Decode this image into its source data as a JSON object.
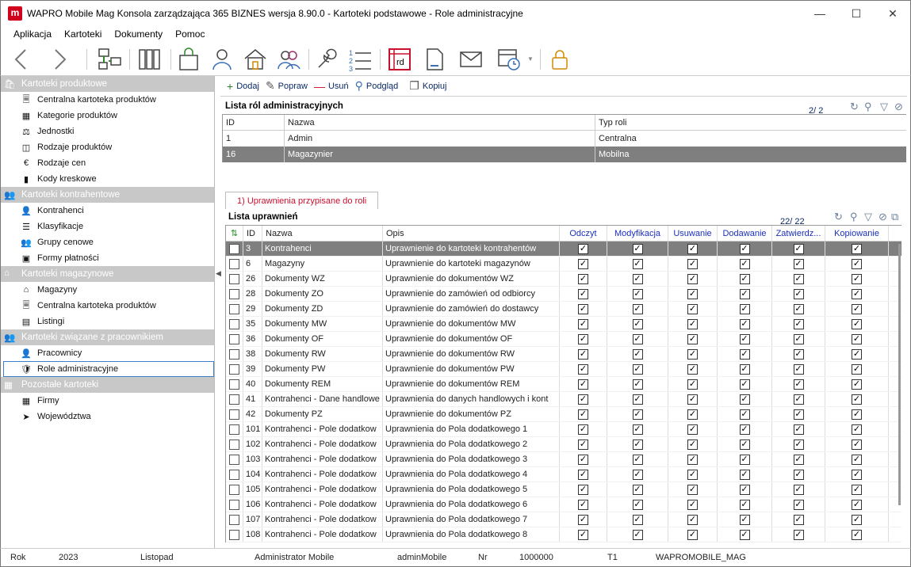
{
  "window": {
    "title": "WAPRO Mobile Mag Konsola zarządzająca 365 BIZNES wersja 8.90.0 - Kartoteki podstawowe - Role administracyjne",
    "app_icon_letter": "m"
  },
  "menu": [
    "Aplikacja",
    "Kartoteki",
    "Dokumenty",
    "Pomoc"
  ],
  "toolbar_icons": [
    "back-arrow-icon",
    "forward-arrow-icon",
    "network-icon",
    "binders-icon",
    "shopping-bag-icon",
    "person-icon",
    "house-icon",
    "users-icon",
    "wrench-icon",
    "numbered-list-icon",
    "rd-calendar-icon",
    "document-icon",
    "envelope-icon",
    "calendar-clock-icon",
    "lock-icon"
  ],
  "toolbar_rd_label": "rd",
  "sidebar": {
    "groups": [
      {
        "title": "Kartoteki produktowe",
        "items": [
          "Centralna kartoteka produktów",
          "Kategorie produktów",
          "Jednostki",
          "Rodzaje produktów",
          "Rodzaje cen",
          "Kody kreskowe"
        ]
      },
      {
        "title": "Kartoteki kontrahentowe",
        "items": [
          "Kontrahenci",
          "Klasyfikacje",
          "Grupy cenowe",
          "Formy płatności"
        ]
      },
      {
        "title": "Kartoteki magazynowe",
        "items": [
          "Magazyny",
          "Centralna kartoteka produktów",
          "Listingi"
        ]
      },
      {
        "title": "Kartoteki związane z pracownikiem",
        "items": [
          "Pracownicy",
          "Role administracyjne"
        ]
      },
      {
        "title": "Pozostałe kartoteki",
        "items": [
          "Firmy",
          "Województwa"
        ]
      }
    ],
    "selected": "Role administracyjne"
  },
  "actions": {
    "add": "Dodaj",
    "edit": "Popraw",
    "delete": "Usuń",
    "preview": "Podgląd",
    "copy": "Kopiuj"
  },
  "roles_panel": {
    "title": "Lista ról administracyjnych",
    "count": "2/ 2",
    "columns": [
      "ID",
      "Nazwa",
      "Typ roli"
    ],
    "rows": [
      {
        "id": "1",
        "name": "Admin",
        "type": "Centralna"
      },
      {
        "id": "16",
        "name": "Magazynier",
        "type": "Mobilna"
      }
    ],
    "selected_index": 1
  },
  "tab_label": "1) Uprawnienia przypisane do roli",
  "perms_panel": {
    "title": "Lista uprawnień",
    "count": "22/ 22",
    "columns": [
      "ID",
      "Nazwa",
      "Opis",
      "Odczyt",
      "Modyfikacja",
      "Usuwanie",
      "Dodawanie",
      "Zatwierdz...",
      "Kopiowanie"
    ],
    "rows": [
      {
        "id": "3",
        "name": "Kontrahenci",
        "desc": "Uprawnienie do kartoteki kontrahentów"
      },
      {
        "id": "6",
        "name": "Magazyny",
        "desc": "Uprawnienie do kartoteki magazynów"
      },
      {
        "id": "26",
        "name": "Dokumenty WZ",
        "desc": "Uprawnienie do dokumentów WZ"
      },
      {
        "id": "28",
        "name": "Dokumenty ZO",
        "desc": "Uprawnienie do zamówień od odbiorcy"
      },
      {
        "id": "29",
        "name": "Dokumenty ZD",
        "desc": "Uprawnienie do zamówień do dostawcy"
      },
      {
        "id": "35",
        "name": "Dokumenty MW",
        "desc": "Uprawnienie do dokumentów MW"
      },
      {
        "id": "36",
        "name": "Dokumenty OF",
        "desc": "Uprawnienie do dokumentów OF"
      },
      {
        "id": "38",
        "name": "Dokumenty RW",
        "desc": "Uprawnienie do dokumentów RW"
      },
      {
        "id": "39",
        "name": "Dokumenty PW",
        "desc": "Uprawnienie do dokumentów PW"
      },
      {
        "id": "40",
        "name": "Dokumenty REM",
        "desc": "Uprawnienie do dokumentów REM"
      },
      {
        "id": "41",
        "name": "Kontrahenci - Dane handlowe",
        "desc": "Uprawnienia do danych handlowych i kont"
      },
      {
        "id": "42",
        "name": "Dokumenty PZ",
        "desc": "Uprawnienie do dokumentów PZ"
      },
      {
        "id": "101",
        "name": "Kontrahenci - Pole dodatkow",
        "desc": "Uprawnienia do Pola dodatkowego 1"
      },
      {
        "id": "102",
        "name": "Kontrahenci - Pole dodatkow",
        "desc": "Uprawnienia do Pola dodatkowego 2"
      },
      {
        "id": "103",
        "name": "Kontrahenci - Pole dodatkow",
        "desc": "Uprawnienia do Pola dodatkowego 3"
      },
      {
        "id": "104",
        "name": "Kontrahenci - Pole dodatkow",
        "desc": "Uprawnienia do Pola dodatkowego 4"
      },
      {
        "id": "105",
        "name": "Kontrahenci - Pole dodatkow",
        "desc": "Uprawnienia do Pola dodatkowego 5"
      },
      {
        "id": "106",
        "name": "Kontrahenci - Pole dodatkow",
        "desc": "Uprawnienia do Pola dodatkowego 6"
      },
      {
        "id": "107",
        "name": "Kontrahenci - Pole dodatkow",
        "desc": "Uprawnienia do Pola dodatkowego 7"
      },
      {
        "id": "108",
        "name": "Kontrahenci - Pole dodatkow",
        "desc": "Uprawnienia do Pola dodatkowego 8"
      }
    ],
    "selected_index": 0
  },
  "status": {
    "rok_label": "Rok",
    "rok_value": "2023",
    "month": "Listopad",
    "user_role": "Administrator Mobile",
    "login": "adminMobile",
    "nr_label": "Nr",
    "nr_value": "1000000",
    "t": "T1",
    "db": "WAPROMOBILE_MAG"
  },
  "colors": {
    "accent_red": "#d0021b",
    "selected_row": "#7f7f7f",
    "group_header": "#c8c8c8",
    "column_blue": "#1a2fbf"
  }
}
